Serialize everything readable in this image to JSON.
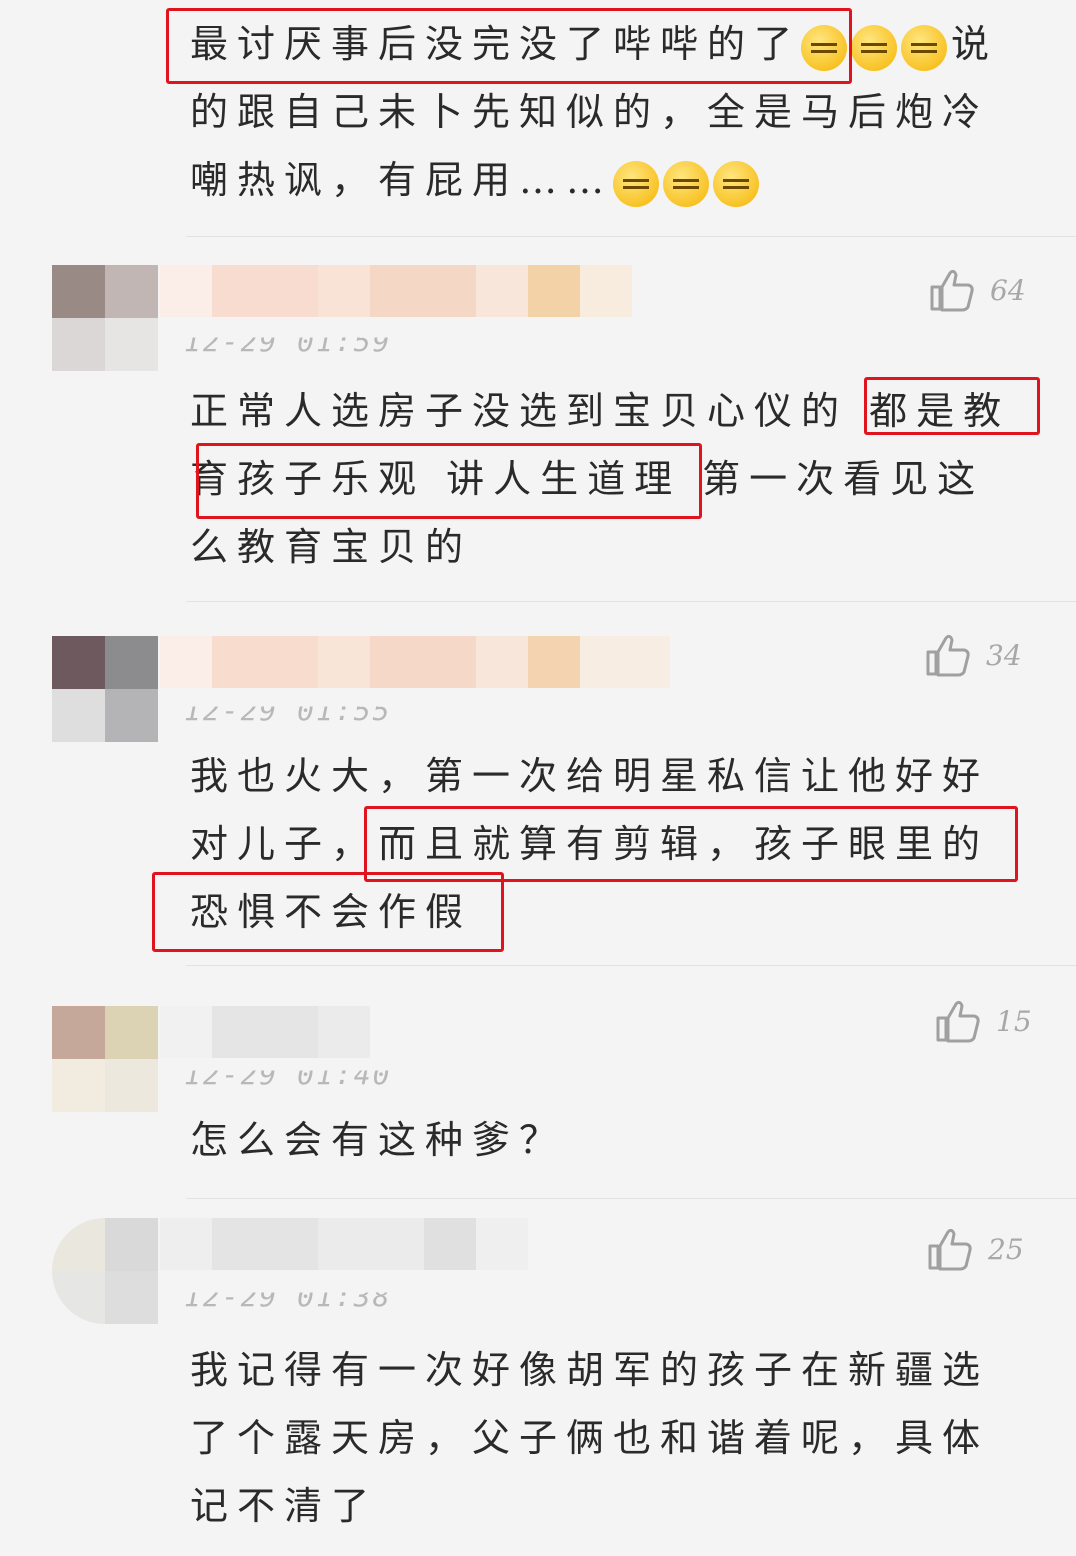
{
  "comments": [
    {
      "text_before": "最讨厌事后没完没了哔哔的了",
      "text_after": "说的跟自己未卜先知似的，全是马后炮冷嘲热讽，有屁用……",
      "emoji_a": "grimace-emoji",
      "emoji_b": "angry-emoji"
    },
    {
      "likes": "64",
      "time": "12-29 01:59",
      "text": "正常人选房子没选到宝贝心仪的 都是教育孩子乐观 讲人生道理 第一次看见这么教育宝贝的"
    },
    {
      "likes": "34",
      "time": "12-29 01:55",
      "text": "我也火大，第一次给明星私信让他好好对儿子，而且就算有剪辑，孩子眼里的恐惧不会作假"
    },
    {
      "likes": "15",
      "time": "12-29 01:40",
      "text": "怎么会有这种爹？"
    },
    {
      "likes": "25",
      "time": "12-29 01:38",
      "text": "我记得有一次好像胡军的孩子在新疆选了个露天房，父子俩也和谐着呢，具体记不清了"
    }
  ],
  "colors": {
    "highlight_box": "#e0141e",
    "background": "#f4f4f4"
  },
  "icons": {
    "like": "thumbs-up-icon"
  }
}
